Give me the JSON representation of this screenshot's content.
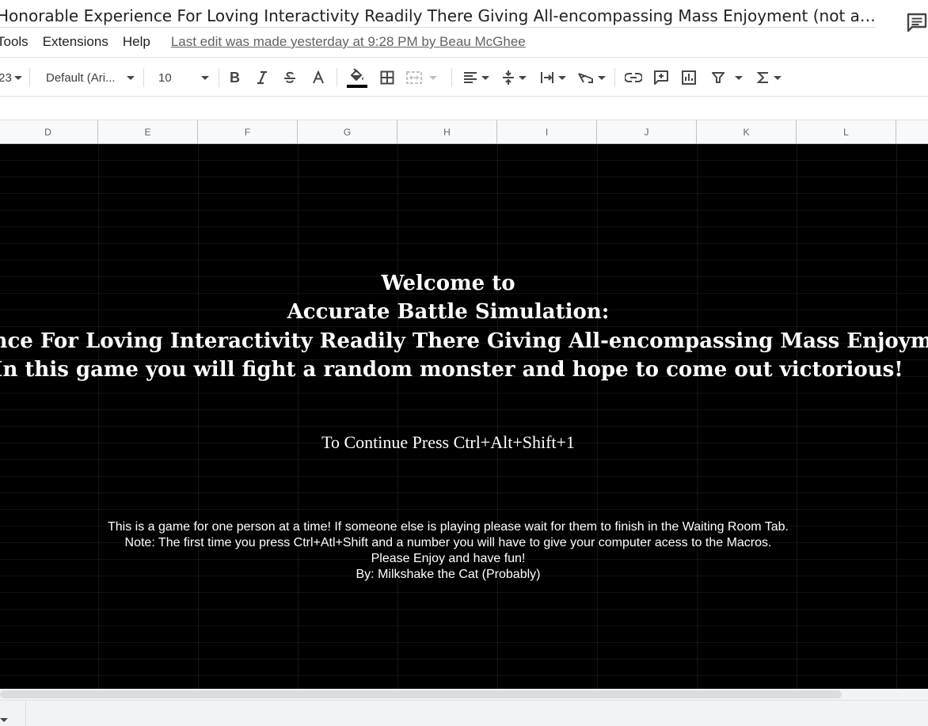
{
  "document": {
    "title": "Honorable Experience For Loving Interactivity Readily There Giving All-encompassing Mass Enjoyment (not a virus)"
  },
  "menu": {
    "items": [
      "Tools",
      "Extensions",
      "Help"
    ],
    "last_edit": "Last edit was made yesterday at 9:28 PM by Beau McGhee"
  },
  "toolbar": {
    "format_label": "23",
    "font_label": "Default (Ari...",
    "font_size": "10",
    "fill_color": "#000000"
  },
  "columns": [
    "D",
    "E",
    "F",
    "G",
    "H",
    "I",
    "J",
    "K",
    "L"
  ],
  "game": {
    "welcome": "Welcome to",
    "subtitle": "Accurate Battle Simulation:",
    "long_title": "Honorable Experience For Loving Interactivity Readily There Giving All-encompassing Mass Enjoyment (not a virus)",
    "intro": "In this game you will fight a random monster and hope to come out victorious!",
    "continue": "To Continue Press Ctrl+Alt+Shift+1",
    "notes": [
      "This is a game for one person at a time! If someone else is playing please wait for them to finish in the Waiting Room Tab.",
      "Note: The first time you press Ctrl+Atl+Shift and a number you will have to give your computer acess to the Macros.",
      "Please Enjoy and have fun!",
      "By: Milkshake the Cat (Probably)"
    ]
  }
}
